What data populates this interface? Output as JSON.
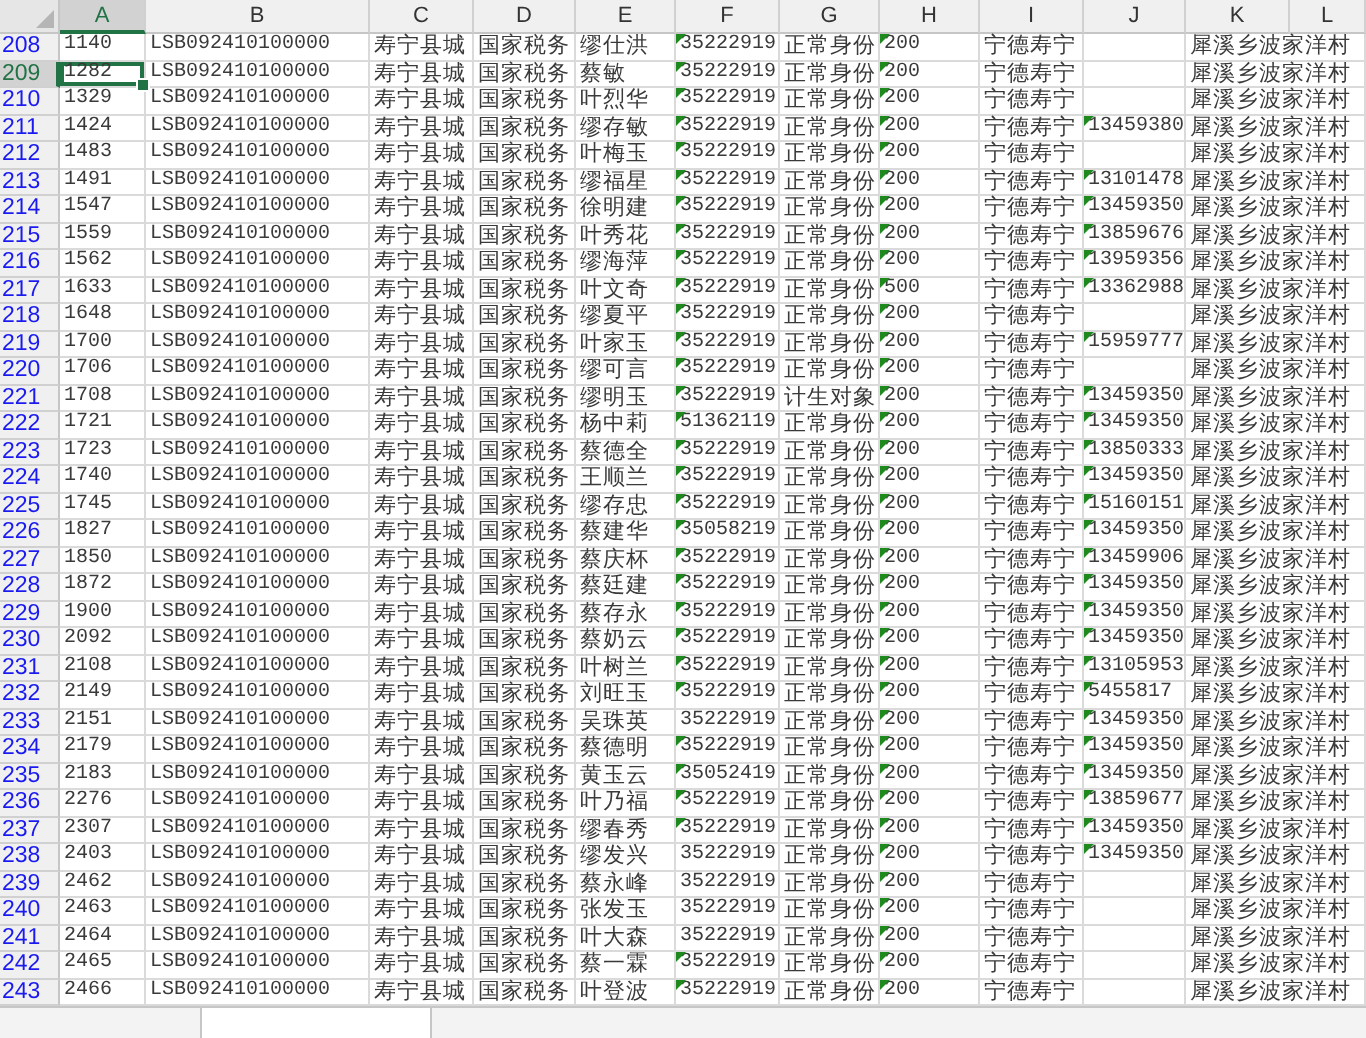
{
  "columns": [
    {
      "label": "A",
      "selected": true
    },
    {
      "label": "B",
      "selected": false
    },
    {
      "label": "C",
      "selected": false
    },
    {
      "label": "D",
      "selected": false
    },
    {
      "label": "E",
      "selected": false
    },
    {
      "label": "F",
      "selected": false
    },
    {
      "label": "G",
      "selected": false
    },
    {
      "label": "H",
      "selected": false
    },
    {
      "label": "I",
      "selected": false
    },
    {
      "label": "J",
      "selected": false
    },
    {
      "label": "K",
      "selected": false
    },
    {
      "label": "L",
      "selected": false
    }
  ],
  "rows": [
    {
      "row": "208",
      "selected": false,
      "a": "1140",
      "b": "LSB092410100000",
      "c": "寿宁县城",
      "d": "国家税务",
      "e": "缪仕洪",
      "f": "35222919",
      "f_flag": true,
      "g": "正常身份",
      "h": "200",
      "h_flag": true,
      "i": "宁德寿宁",
      "k": "犀溪乡波家洋村"
    },
    {
      "row": "209",
      "selected": true,
      "a": "1282",
      "b": "LSB092410100000",
      "c": "寿宁县城",
      "d": "国家税务",
      "e": "蔡敏",
      "f": "35222919",
      "f_flag": true,
      "g": "正常身份",
      "h": "200",
      "h_flag": true,
      "i": "宁德寿宁",
      "k": "犀溪乡波家洋村"
    },
    {
      "row": "210",
      "selected": false,
      "a": "1329",
      "b": "LSB092410100000",
      "c": "寿宁县城",
      "d": "国家税务",
      "e": "叶烈华",
      "f": "35222919",
      "f_flag": true,
      "g": "正常身份",
      "h": "200",
      "h_flag": true,
      "i": "宁德寿宁",
      "k": "犀溪乡波家洋村"
    },
    {
      "row": "211",
      "selected": false,
      "a": "1424",
      "b": "LSB092410100000",
      "c": "寿宁县城",
      "d": "国家税务",
      "e": "缪存敏",
      "f": "35222919",
      "f_flag": true,
      "g": "正常身份",
      "h": "200",
      "h_flag": true,
      "i": "宁德寿宁",
      "j": "13459380",
      "j_flag": true,
      "k": "犀溪乡波家洋村"
    },
    {
      "row": "212",
      "selected": false,
      "a": "1483",
      "b": "LSB092410100000",
      "c": "寿宁县城",
      "d": "国家税务",
      "e": "叶梅玉",
      "f": "35222919",
      "f_flag": true,
      "g": "正常身份",
      "h": "200",
      "h_flag": true,
      "i": "宁德寿宁",
      "k": "犀溪乡波家洋村"
    },
    {
      "row": "213",
      "selected": false,
      "a": "1491",
      "b": "LSB092410100000",
      "c": "寿宁县城",
      "d": "国家税务",
      "e": "缪福星",
      "f": "35222919",
      "f_flag": true,
      "g": "正常身份",
      "h": "200",
      "h_flag": true,
      "i": "宁德寿宁",
      "j": "13101478",
      "j_flag": true,
      "k": "犀溪乡波家洋村"
    },
    {
      "row": "214",
      "selected": false,
      "a": "1547",
      "b": "LSB092410100000",
      "c": "寿宁县城",
      "d": "国家税务",
      "e": "徐明建",
      "f": "35222919",
      "f_flag": true,
      "g": "正常身份",
      "h": "200",
      "h_flag": true,
      "i": "宁德寿宁",
      "j": "13459350",
      "j_flag": true,
      "k": "犀溪乡波家洋村"
    },
    {
      "row": "215",
      "selected": false,
      "a": "1559",
      "b": "LSB092410100000",
      "c": "寿宁县城",
      "d": "国家税务",
      "e": "叶秀花",
      "f": "35222919",
      "f_flag": true,
      "g": "正常身份",
      "h": "200",
      "h_flag": true,
      "i": "宁德寿宁",
      "j": "13859676",
      "j_flag": true,
      "k": "犀溪乡波家洋村"
    },
    {
      "row": "216",
      "selected": false,
      "a": "1562",
      "b": "LSB092410100000",
      "c": "寿宁县城",
      "d": "国家税务",
      "e": "缪海萍",
      "f": "35222919",
      "f_flag": true,
      "g": "正常身份",
      "h": "200",
      "h_flag": true,
      "i": "宁德寿宁",
      "j": "13959356",
      "j_flag": true,
      "k": "犀溪乡波家洋村"
    },
    {
      "row": "217",
      "selected": false,
      "a": "1633",
      "b": "LSB092410100000",
      "c": "寿宁县城",
      "d": "国家税务",
      "e": "叶文奇",
      "f": "35222919",
      "f_flag": true,
      "g": "正常身份",
      "h": "500",
      "h_flag": true,
      "i": "宁德寿宁",
      "j": "13362988",
      "j_flag": true,
      "k": "犀溪乡波家洋村"
    },
    {
      "row": "218",
      "selected": false,
      "a": "1648",
      "b": "LSB092410100000",
      "c": "寿宁县城",
      "d": "国家税务",
      "e": "缪夏平",
      "f": "35222919",
      "f_flag": true,
      "g": "正常身份",
      "h": "200",
      "h_flag": true,
      "i": "宁德寿宁",
      "k": "犀溪乡波家洋村"
    },
    {
      "row": "219",
      "selected": false,
      "a": "1700",
      "b": "LSB092410100000",
      "c": "寿宁县城",
      "d": "国家税务",
      "e": "叶家玉",
      "f": "35222919",
      "f_flag": true,
      "g": "正常身份",
      "h": "200",
      "h_flag": true,
      "i": "宁德寿宁",
      "j": "15959777",
      "j_flag": true,
      "k": "犀溪乡波家洋村"
    },
    {
      "row": "220",
      "selected": false,
      "a": "1706",
      "b": "LSB092410100000",
      "c": "寿宁县城",
      "d": "国家税务",
      "e": "缪可言",
      "f": "35222919",
      "f_flag": true,
      "g": "正常身份",
      "h": "200",
      "h_flag": true,
      "i": "宁德寿宁",
      "k": "犀溪乡波家洋村"
    },
    {
      "row": "221",
      "selected": false,
      "a": "1708",
      "b": "LSB092410100000",
      "c": "寿宁县城",
      "d": "国家税务",
      "e": "缪明玉",
      "f": "35222919",
      "f_flag": true,
      "g": "计生对象",
      "h": "200",
      "h_flag": true,
      "i": "宁德寿宁",
      "j": "13459350",
      "j_flag": true,
      "k": "犀溪乡波家洋村"
    },
    {
      "row": "222",
      "selected": false,
      "a": "1721",
      "b": "LSB092410100000",
      "c": "寿宁县城",
      "d": "国家税务",
      "e": "杨中莉",
      "f": "51362119",
      "f_flag": true,
      "g": "正常身份",
      "h": "200",
      "h_flag": true,
      "i": "宁德寿宁",
      "j": "13459350",
      "j_flag": true,
      "k": "犀溪乡波家洋村"
    },
    {
      "row": "223",
      "selected": false,
      "a": "1723",
      "b": "LSB092410100000",
      "c": "寿宁县城",
      "d": "国家税务",
      "e": "蔡德全",
      "f": "35222919",
      "f_flag": true,
      "g": "正常身份",
      "h": "200",
      "h_flag": true,
      "i": "宁德寿宁",
      "j": "13850333",
      "j_flag": true,
      "k": "犀溪乡波家洋村"
    },
    {
      "row": "224",
      "selected": false,
      "a": "1740",
      "b": "LSB092410100000",
      "c": "寿宁县城",
      "d": "国家税务",
      "e": "王顺兰",
      "f": "35222919",
      "f_flag": true,
      "g": "正常身份",
      "h": "200",
      "h_flag": true,
      "i": "宁德寿宁",
      "j": "13459350",
      "j_flag": true,
      "k": "犀溪乡波家洋村"
    },
    {
      "row": "225",
      "selected": false,
      "a": "1745",
      "b": "LSB092410100000",
      "c": "寿宁县城",
      "d": "国家税务",
      "e": "缪存忠",
      "f": "35222919",
      "f_flag": true,
      "g": "正常身份",
      "h": "200",
      "h_flag": true,
      "i": "宁德寿宁",
      "j": "15160151",
      "j_flag": true,
      "k": "犀溪乡波家洋村"
    },
    {
      "row": "226",
      "selected": false,
      "a": "1827",
      "b": "LSB092410100000",
      "c": "寿宁县城",
      "d": "国家税务",
      "e": "蔡建华",
      "f": "35058219",
      "f_flag": true,
      "g": "正常身份",
      "h": "200",
      "h_flag": true,
      "i": "宁德寿宁",
      "j": "13459350",
      "j_flag": true,
      "k": "犀溪乡波家洋村"
    },
    {
      "row": "227",
      "selected": false,
      "a": "1850",
      "b": "LSB092410100000",
      "c": "寿宁县城",
      "d": "国家税务",
      "e": "蔡庆杯",
      "f": "35222919",
      "f_flag": true,
      "g": "正常身份",
      "h": "200",
      "h_flag": true,
      "i": "宁德寿宁",
      "j": "13459906",
      "j_flag": true,
      "k": "犀溪乡波家洋村"
    },
    {
      "row": "228",
      "selected": false,
      "a": "1872",
      "b": "LSB092410100000",
      "c": "寿宁县城",
      "d": "国家税务",
      "e": "蔡廷建",
      "f": "35222919",
      "f_flag": true,
      "g": "正常身份",
      "h": "200",
      "h_flag": true,
      "i": "宁德寿宁",
      "j": "13459350",
      "j_flag": true,
      "k": "犀溪乡波家洋村"
    },
    {
      "row": "229",
      "selected": false,
      "a": "1900",
      "b": "LSB092410100000",
      "c": "寿宁县城",
      "d": "国家税务",
      "e": "蔡存永",
      "f": "35222919",
      "f_flag": true,
      "g": "正常身份",
      "h": "200",
      "h_flag": true,
      "i": "宁德寿宁",
      "j": "13459350",
      "j_flag": true,
      "k": "犀溪乡波家洋村"
    },
    {
      "row": "230",
      "selected": false,
      "a": "2092",
      "b": "LSB092410100000",
      "c": "寿宁县城",
      "d": "国家税务",
      "e": "蔡奶云",
      "f": "35222919",
      "f_flag": true,
      "g": "正常身份",
      "h": "200",
      "h_flag": true,
      "i": "宁德寿宁",
      "j": "13459350",
      "j_flag": true,
      "k": "犀溪乡波家洋村"
    },
    {
      "row": "231",
      "selected": false,
      "a": "2108",
      "b": "LSB092410100000",
      "c": "寿宁县城",
      "d": "国家税务",
      "e": "叶树兰",
      "f": "35222919",
      "f_flag": true,
      "g": "正常身份",
      "h": "200",
      "h_flag": true,
      "i": "宁德寿宁",
      "j": "13105953",
      "j_flag": true,
      "k": "犀溪乡波家洋村"
    },
    {
      "row": "232",
      "selected": false,
      "a": "2149",
      "b": "LSB092410100000",
      "c": "寿宁县城",
      "d": "国家税务",
      "e": "刘旺玉",
      "f": "35222919",
      "f_flag": true,
      "g": "正常身份",
      "h": "200",
      "h_flag": true,
      "i": "宁德寿宁",
      "j": "5455817",
      "j_flag": true,
      "k": "犀溪乡波家洋村"
    },
    {
      "row": "233",
      "selected": false,
      "a": "2151",
      "b": "LSB092410100000",
      "c": "寿宁县城",
      "d": "国家税务",
      "e": "吴珠英",
      "f": "35222919",
      "f_flag": false,
      "g": "正常身份",
      "h": "200",
      "h_flag": true,
      "i": "宁德寿宁",
      "j": "13459350",
      "j_flag": true,
      "k": "犀溪乡波家洋村"
    },
    {
      "row": "234",
      "selected": false,
      "a": "2179",
      "b": "LSB092410100000",
      "c": "寿宁县城",
      "d": "国家税务",
      "e": "蔡德明",
      "f": "35222919",
      "f_flag": true,
      "g": "正常身份",
      "h": "200",
      "h_flag": true,
      "i": "宁德寿宁",
      "j": "13459350",
      "j_flag": true,
      "k": "犀溪乡波家洋村"
    },
    {
      "row": "235",
      "selected": false,
      "a": "2183",
      "b": "LSB092410100000",
      "c": "寿宁县城",
      "d": "国家税务",
      "e": "黄玉云",
      "f": "35052419",
      "f_flag": true,
      "g": "正常身份",
      "h": "200",
      "h_flag": true,
      "i": "宁德寿宁",
      "j": "13459350",
      "j_flag": true,
      "k": "犀溪乡波家洋村"
    },
    {
      "row": "236",
      "selected": false,
      "a": "2276",
      "b": "LSB092410100000",
      "c": "寿宁县城",
      "d": "国家税务",
      "e": "叶乃福",
      "f": "35222919",
      "f_flag": true,
      "g": "正常身份",
      "h": "200",
      "h_flag": true,
      "i": "宁德寿宁",
      "j": "13859677",
      "j_flag": true,
      "k": "犀溪乡波家洋村"
    },
    {
      "row": "237",
      "selected": false,
      "a": "2307",
      "b": "LSB092410100000",
      "c": "寿宁县城",
      "d": "国家税务",
      "e": "缪春秀",
      "f": "35222919",
      "f_flag": true,
      "g": "正常身份",
      "h": "200",
      "h_flag": true,
      "i": "宁德寿宁",
      "j": "13459350",
      "j_flag": true,
      "k": "犀溪乡波家洋村"
    },
    {
      "row": "238",
      "selected": false,
      "a": "2403",
      "b": "LSB092410100000",
      "c": "寿宁县城",
      "d": "国家税务",
      "e": "缪发兴",
      "f": "35222919",
      "f_flag": false,
      "g": "正常身份",
      "h": "200",
      "h_flag": true,
      "i": "宁德寿宁",
      "j": "13459350",
      "j_flag": true,
      "k": "犀溪乡波家洋村"
    },
    {
      "row": "239",
      "selected": false,
      "a": "2462",
      "b": "LSB092410100000",
      "c": "寿宁县城",
      "d": "国家税务",
      "e": "蔡永峰",
      "f": "35222919",
      "f_flag": false,
      "g": "正常身份",
      "h": "200",
      "h_flag": true,
      "i": "宁德寿宁",
      "k": "犀溪乡波家洋村"
    },
    {
      "row": "240",
      "selected": false,
      "a": "2463",
      "b": "LSB092410100000",
      "c": "寿宁县城",
      "d": "国家税务",
      "e": "张发玉",
      "f": "35222919",
      "f_flag": false,
      "g": "正常身份",
      "h": "200",
      "h_flag": true,
      "i": "宁德寿宁",
      "k": "犀溪乡波家洋村"
    },
    {
      "row": "241",
      "selected": false,
      "a": "2464",
      "b": "LSB092410100000",
      "c": "寿宁县城",
      "d": "国家税务",
      "e": "叶大森",
      "f": "35222919",
      "f_flag": false,
      "g": "正常身份",
      "h": "200",
      "h_flag": true,
      "i": "宁德寿宁",
      "k": "犀溪乡波家洋村"
    },
    {
      "row": "242",
      "selected": false,
      "a": "2465",
      "b": "LSB092410100000",
      "c": "寿宁县城",
      "d": "国家税务",
      "e": "蔡一霖",
      "f": "35222919",
      "f_flag": true,
      "g": "正常身份",
      "h": "200",
      "h_flag": true,
      "i": "宁德寿宁",
      "k": "犀溪乡波家洋村"
    },
    {
      "row": "243",
      "selected": false,
      "a": "2466",
      "b": "LSB092410100000",
      "c": "寿宁县城",
      "d": "国家税务",
      "e": "叶登波",
      "f": "35222919",
      "f_flag": true,
      "g": "正常身份",
      "h": "200",
      "h_flag": true,
      "i": "宁德寿宁",
      "k": "犀溪乡波家洋村"
    }
  ]
}
